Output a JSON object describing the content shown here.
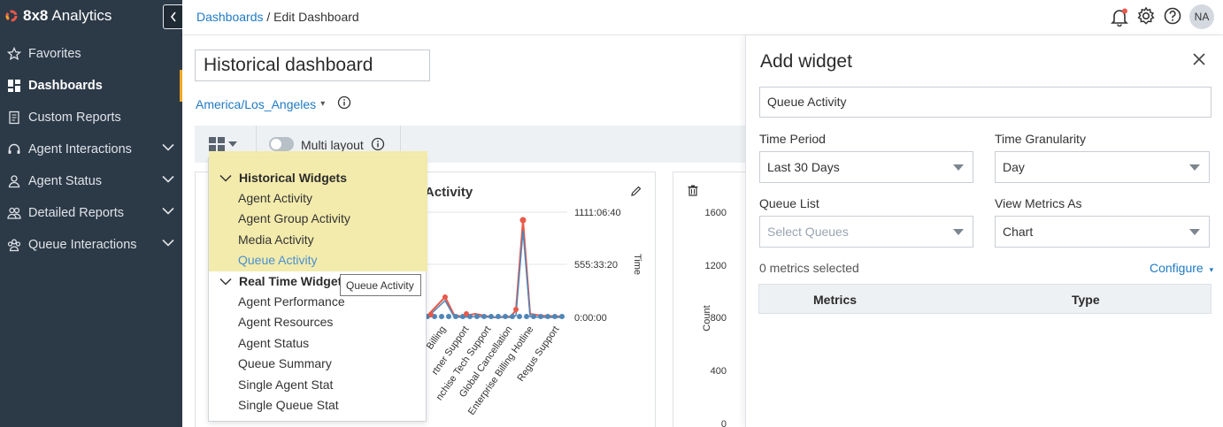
{
  "sidebar": {
    "brand_bold": "8x8",
    "brand_rest": "Analytics",
    "items": [
      {
        "label": "Favorites",
        "icon": "star-icon"
      },
      {
        "label": "Dashboards",
        "icon": "dashboard-grid-icon"
      },
      {
        "label": "Custom Reports",
        "icon": "report-icon"
      },
      {
        "label": "Agent Interactions",
        "icon": "headset-icon"
      },
      {
        "label": "Agent Status",
        "icon": "person-icon"
      },
      {
        "label": "Detailed Reports",
        "icon": "people-icon"
      },
      {
        "label": "Queue Interactions",
        "icon": "group-icon"
      }
    ]
  },
  "header": {
    "breadcrumb_link": "Dashboards",
    "breadcrumb_sep": " / ",
    "breadcrumb_current": "Edit Dashboard",
    "avatar": "NA"
  },
  "dashboard": {
    "title": "Historical dashboard",
    "timezone": "America/Los_Angeles",
    "multi_layout_label": "Multi layout"
  },
  "widget1": {
    "title_fragment": "Activity",
    "right_axis_ticks": [
      "1111:06:40",
      "555:33:20",
      "0:00:00"
    ],
    "right_axis_label": "Time",
    "x_labels": [
      "Billing",
      "rtner Support",
      "nchise Tech Support",
      "Global Cancellation",
      "Enterprise Billing Hotline",
      "Regus Support"
    ]
  },
  "widget2": {
    "y_ticks": [
      "1600",
      "1200",
      "800",
      "400",
      "0"
    ],
    "y_label": "Count"
  },
  "menu": {
    "historical_header": "Historical Widgets",
    "historical_items": [
      "Agent Activity",
      "Agent Group Activity",
      "Media Activity",
      "Queue Activity"
    ],
    "realtime_header": "Real Time Widget",
    "realtime_items": [
      "Agent Performance",
      "Agent Resources",
      "Agent Status",
      "Queue Summary",
      "Single Agent Stat",
      "Single Queue Stat"
    ],
    "tooltip": "Queue Activity"
  },
  "panel": {
    "title": "Add widget",
    "widget_name": "Queue Activity",
    "time_period_label": "Time Period",
    "time_period_value": "Last 30 Days",
    "time_granularity_label": "Time Granularity",
    "time_granularity_value": "Day",
    "queue_list_label": "Queue List",
    "queue_list_placeholder": "Select Queues",
    "view_metrics_label": "View Metrics As",
    "view_metrics_value": "Chart",
    "metrics_selected": "0 metrics selected",
    "configure": "Configure",
    "col_metrics": "Metrics",
    "col_type": "Type"
  },
  "colors": {
    "sidebar_bg": "#2c3947",
    "accent_orange": "#f5a623",
    "link_blue": "#1f7ac4",
    "menu_highlight": "#f2eaa8",
    "series_red": "#e8594a",
    "series_blue": "#4f86b8"
  }
}
